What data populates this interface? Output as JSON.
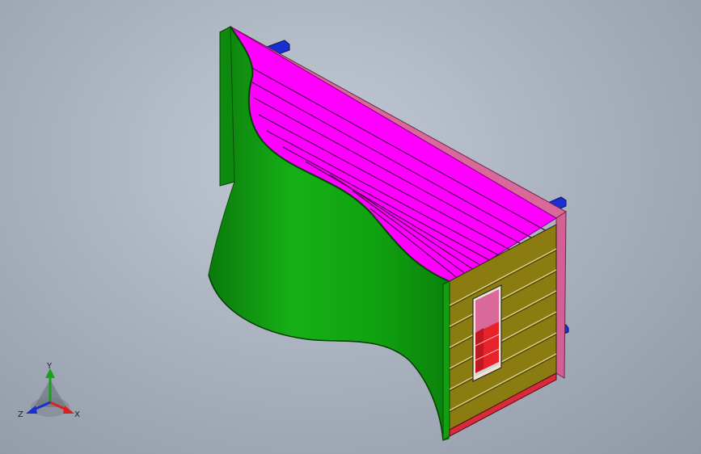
{
  "viewport": {
    "background_center": "#c3cad4",
    "background_edge": "#8f98a5"
  },
  "model": {
    "colors": {
      "green_body": "#12a012",
      "green_dark": "#0a6e0a",
      "magenta_louver": "#ff00ff",
      "pink_frame": "#d9689b",
      "olive_front": "#8a7c10",
      "blue_pegs": "#1a2fd0",
      "red_opening": "#e8222a"
    }
  },
  "triad": {
    "labels": {
      "x": "X",
      "y": "Y",
      "z": "Z"
    },
    "colors": {
      "x": "#d8201e",
      "y": "#1aa01a",
      "z": "#1c2fd0"
    }
  }
}
